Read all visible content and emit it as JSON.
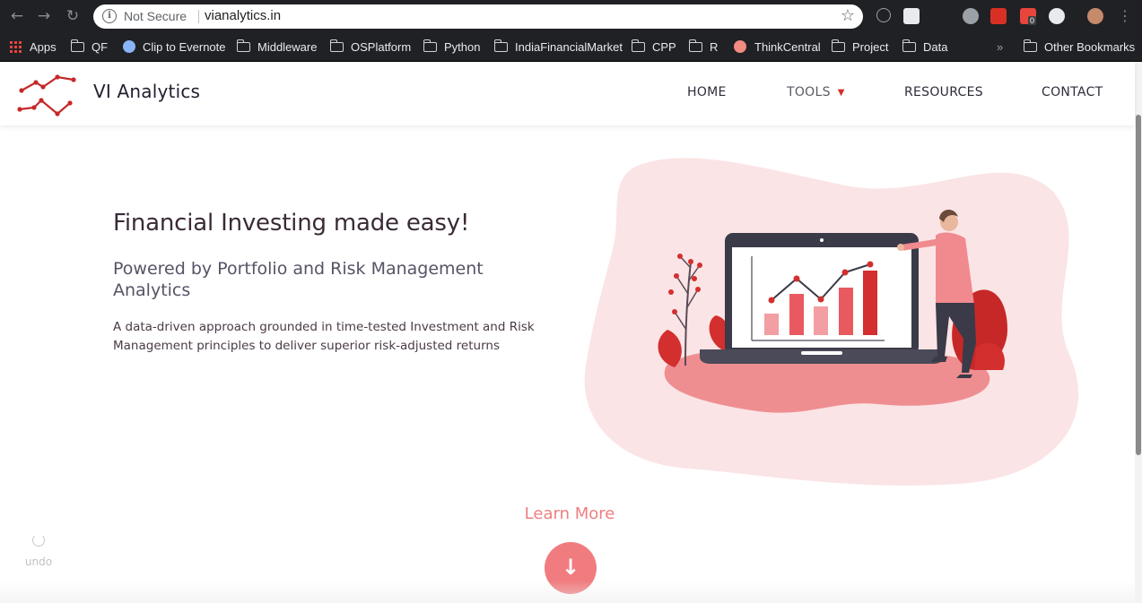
{
  "browser": {
    "security_label": "Not Secure",
    "url": "vianalytics.in",
    "bookmarks": [
      "Apps",
      "QF",
      "Clip to Evernote",
      "Middleware",
      "OSPlatform",
      "Python",
      "IndiaFinancialMarket",
      "CPP",
      "R",
      "ThinkCentral",
      "Project",
      "Data"
    ],
    "more_chevron": "»",
    "other_bookmarks": "Other Bookmarks",
    "ext_badge": "0"
  },
  "site": {
    "brand": "VI Analytics",
    "nav": [
      "HOME",
      "TOOLS",
      "RESOURCES",
      "CONTACT"
    ],
    "accent": "#d32f2f"
  },
  "hero": {
    "title": "Financial Investing made easy!",
    "subtitle": "Powered by Portfolio and Risk Management Analytics",
    "body": "A data-driven approach grounded in time-tested Investment and Risk Management principles to deliver superior risk-adjusted returns"
  },
  "learn_more": "Learn More",
  "undo_label": "undo"
}
